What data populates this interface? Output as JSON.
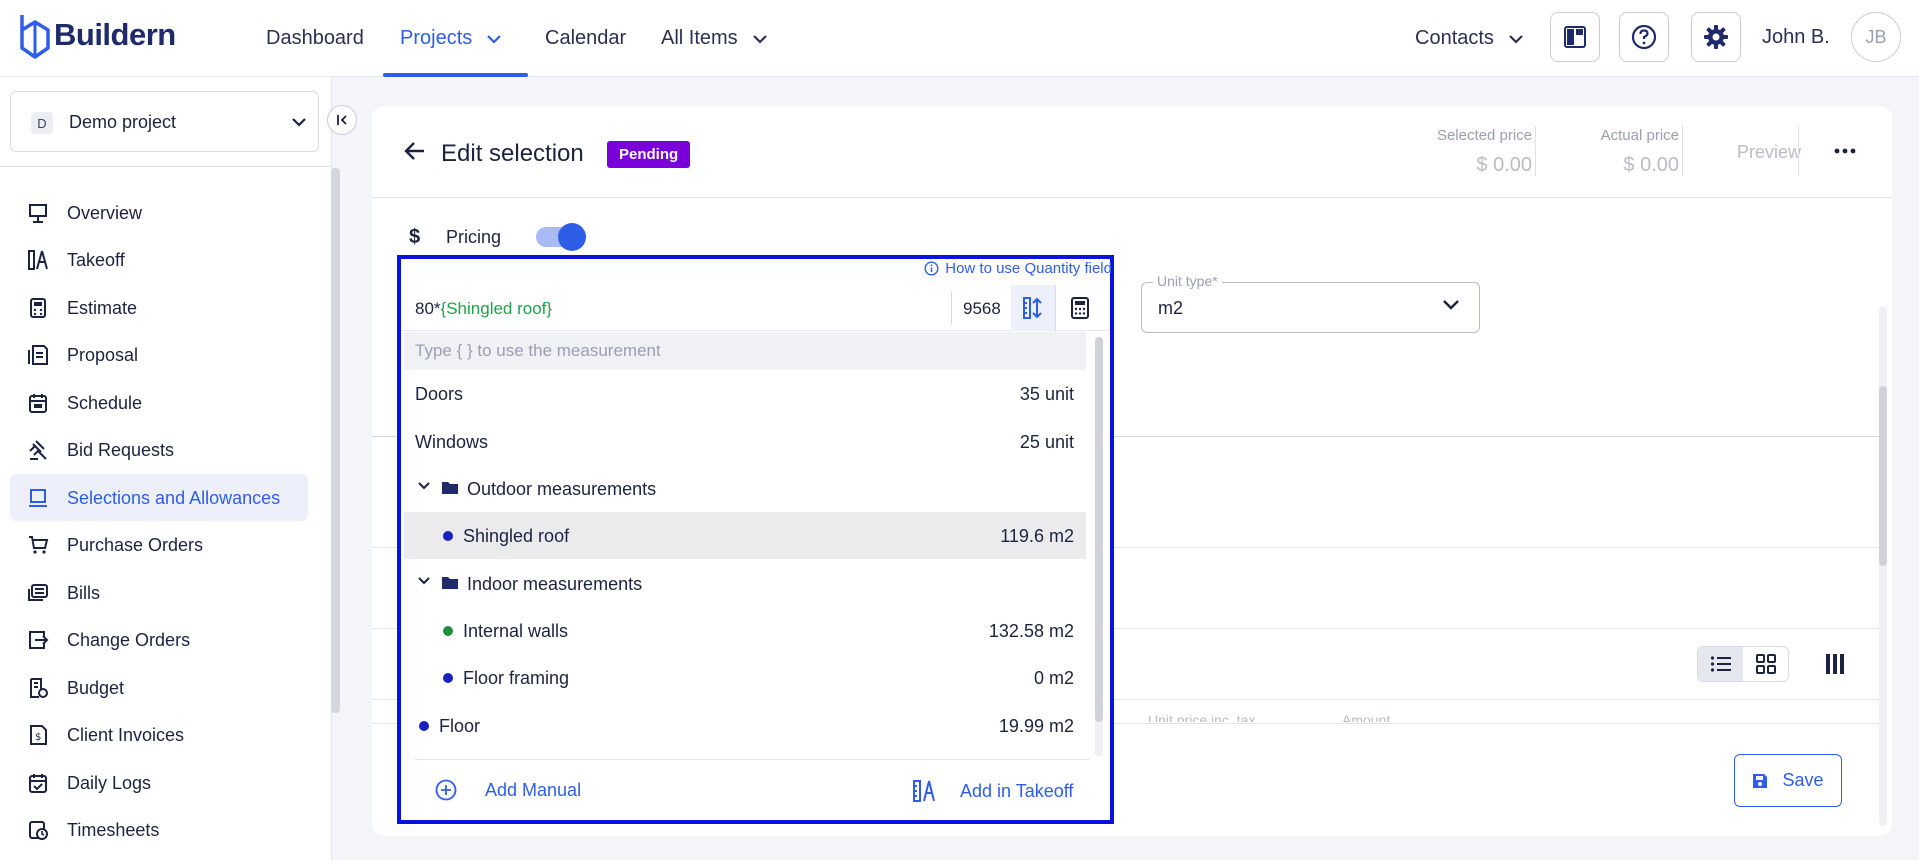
{
  "app": {
    "name": "Buildern"
  },
  "topnav": {
    "items": [
      {
        "label": "Dashboard"
      },
      {
        "label": "Projects"
      },
      {
        "label": "Calendar"
      },
      {
        "label": "All Items"
      }
    ],
    "contacts": "Contacts",
    "username": "John B.",
    "avatar_initials": "JB"
  },
  "project": {
    "badge": "D",
    "name": "Demo project"
  },
  "sidebar": {
    "items": [
      {
        "label": "Overview",
        "icon": "overview-icon"
      },
      {
        "label": "Takeoff",
        "icon": "takeoff-icon"
      },
      {
        "label": "Estimate",
        "icon": "calculator-icon"
      },
      {
        "label": "Proposal",
        "icon": "proposal-icon"
      },
      {
        "label": "Schedule",
        "icon": "calendar-icon"
      },
      {
        "label": "Bid Requests",
        "icon": "gavel-icon"
      },
      {
        "label": "Selections and Allowances",
        "icon": "selections-icon"
      },
      {
        "label": "Purchase Orders",
        "icon": "cart-icon"
      },
      {
        "label": "Bills",
        "icon": "bills-icon"
      },
      {
        "label": "Change Orders",
        "icon": "change-orders-icon"
      },
      {
        "label": "Budget",
        "icon": "budget-icon"
      },
      {
        "label": "Client Invoices",
        "icon": "invoice-icon"
      },
      {
        "label": "Daily Logs",
        "icon": "daily-log-icon"
      },
      {
        "label": "Timesheets",
        "icon": "timesheet-icon"
      }
    ],
    "active": "Selections and Allowances"
  },
  "editor": {
    "title": "Edit selection",
    "status": "Pending",
    "status_color": "#7a00d9",
    "selected_price_label": "Selected price",
    "selected_price": "$ 0.00",
    "actual_price_label": "Actual price",
    "actual_price": "$ 0.00",
    "preview": "Preview",
    "pricing_label": "Pricing",
    "pricing_enabled": true,
    "unit_type_label": "Unit type*",
    "unit_type_value": "m2",
    "column_unit_price": "Unit price inc. tax",
    "column_amount": "Amount",
    "save": "Save"
  },
  "quantity": {
    "help_link": "How to use Quantity field",
    "formula_prefix": "80*",
    "formula_token": "{Shingled roof}",
    "result": "9568",
    "hint": "Type { } to use the measurement",
    "rows": [
      {
        "name": "Doors",
        "value": "35",
        "unit": "unit",
        "type": "item"
      },
      {
        "name": "Windows",
        "value": "25",
        "unit": "unit",
        "type": "item"
      },
      {
        "name": "Outdoor measurements",
        "type": "folder"
      },
      {
        "name": "Shingled roof",
        "value": "119.6",
        "unit": "m2",
        "type": "child",
        "dot_color": "#1a1fbf",
        "highlighted": true
      },
      {
        "name": "Indoor measurements",
        "type": "folder"
      },
      {
        "name": "Internal walls",
        "value": "132.58",
        "unit": "m2",
        "type": "child",
        "dot_color": "#1e8f3e"
      },
      {
        "name": "Floor framing",
        "value": "0",
        "unit": "m2",
        "type": "child",
        "dot_color": "#1a1fbf"
      },
      {
        "name": "Floor",
        "value": "19.99",
        "unit": "m2",
        "type": "root-dot",
        "dot_color": "#1a1fbf"
      }
    ],
    "add_manual": "Add Manual",
    "add_takeoff": "Add in Takeoff"
  },
  "colors": {
    "accent": "#2e5ee8",
    "highlight_border": "#0a12e0"
  }
}
